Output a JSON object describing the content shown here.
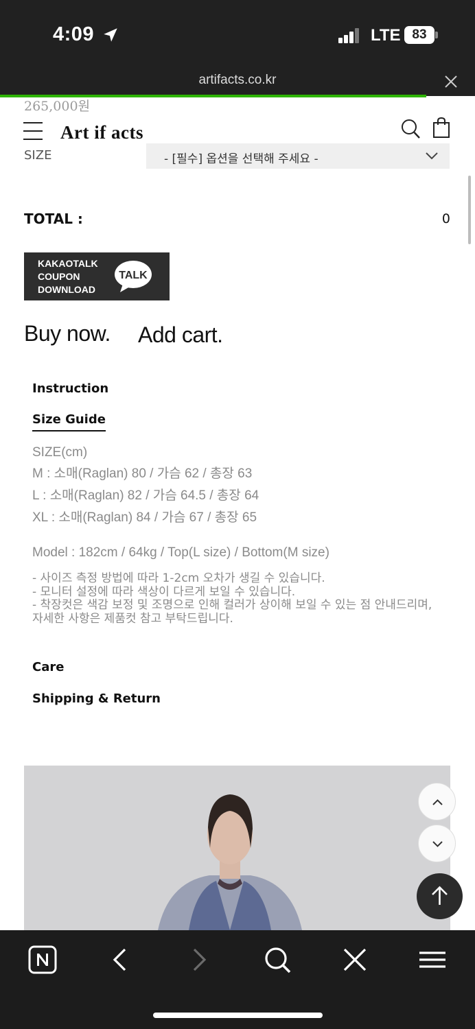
{
  "status_bar": {
    "time": "4:09",
    "network": "LTE",
    "battery": "83"
  },
  "browser": {
    "url": "artifacts.co.kr"
  },
  "header": {
    "logo": "Art if acts"
  },
  "prev_price": "265,000원",
  "option": {
    "label": "SIZE",
    "placeholder": "- [필수] 옵션을 선택해 주세요 -"
  },
  "total": {
    "label": "TOTAL :",
    "value": "0"
  },
  "kakao_coupon": {
    "lines": [
      "KAKAOTALK",
      "COUPON",
      "DOWNLOAD"
    ],
    "badge": "TALK"
  },
  "actions": {
    "buy_now": "Buy now.",
    "add_cart": "Add cart."
  },
  "tabs": {
    "instruction": "Instruction",
    "size_guide": "Size Guide",
    "care": "Care",
    "shipping": "Shipping & Return"
  },
  "size_guide": {
    "title": "SIZE(cm)",
    "rows": [
      "M : 소매(Raglan) 80 / 가슴 62 / 총장 63",
      "L : 소매(Raglan) 82 / 가슴 64.5 / 총장 64",
      "XL : 소매(Raglan) 84 / 가슴 67 / 총장 65"
    ],
    "model": "Model : 182cm / 64kg / Top(L size) / Bottom(M size)",
    "notes": [
      "- 사이즈 측정 방법에 따라 1-2cm 오차가 생길 수 있습니다.",
      "- 모니터 설정에 따라 색상이 다르게 보일 수 있습니다.",
      "- 착장컷은 색감 보정 및 조명으로 인해 컬러가 상이해 보일 수 있는 점 안내드리며, 자세한 사항은 제품컷 참고 부탁드립니다."
    ]
  },
  "colors": {
    "progress": "#2db400",
    "chrome": "#212121",
    "muted_text": "#8a8a8a"
  }
}
